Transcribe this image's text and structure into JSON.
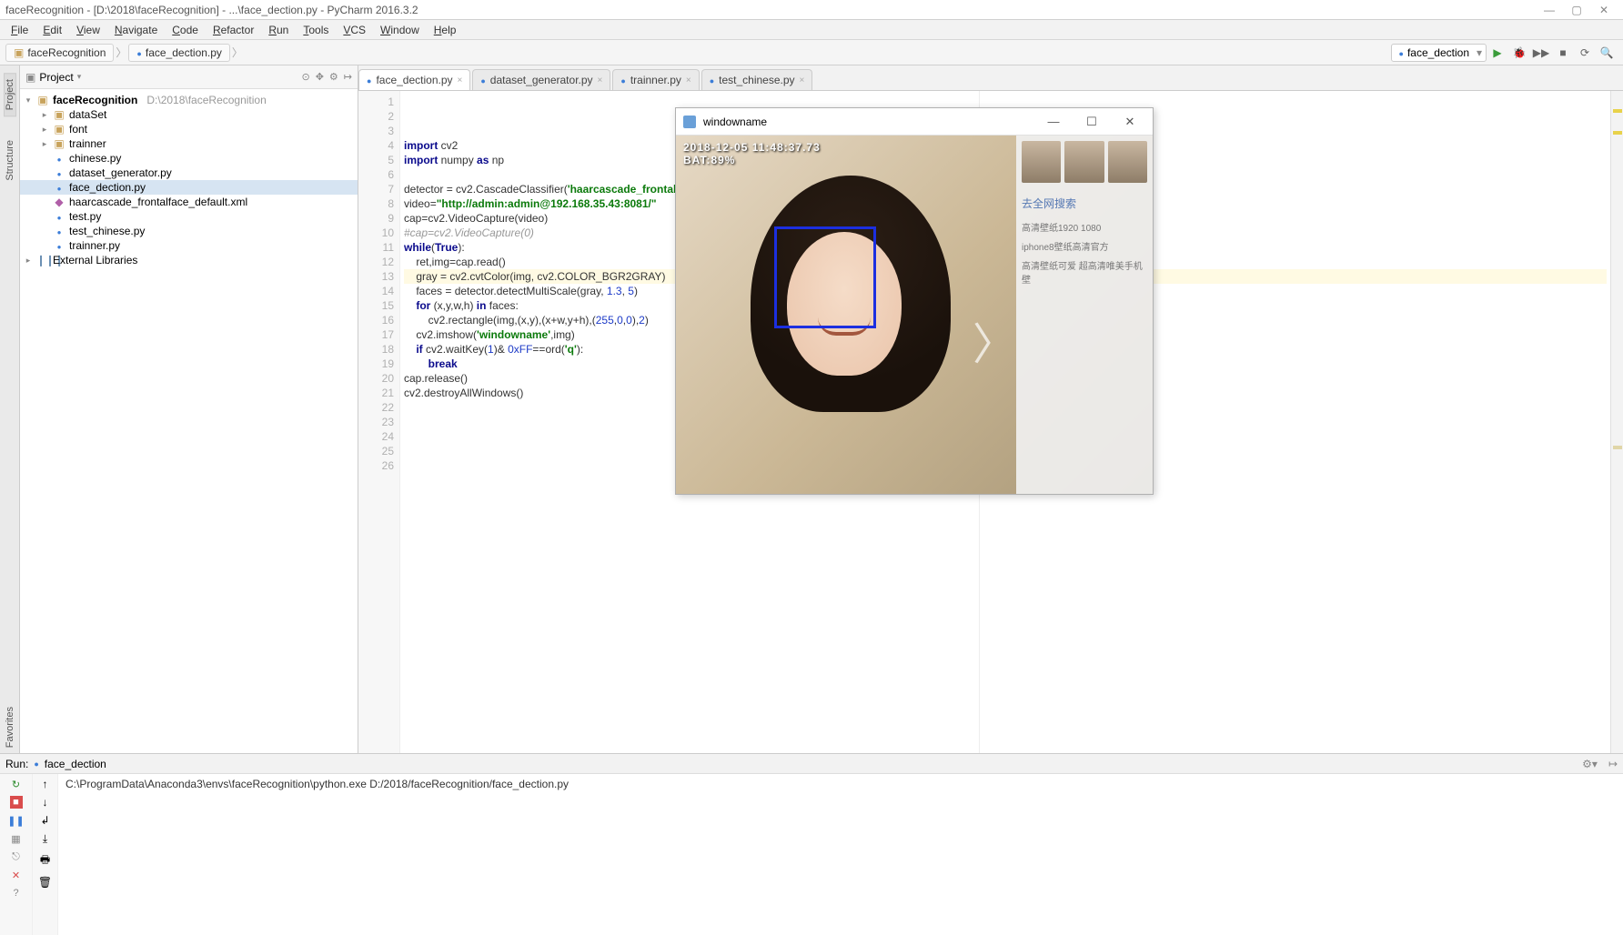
{
  "titlebar": {
    "text": "faceRecognition - [D:\\2018\\faceRecognition] - ...\\face_dection.py - PyCharm 2016.3.2"
  },
  "menu": {
    "items": [
      "File",
      "Edit",
      "View",
      "Navigate",
      "Code",
      "Refactor",
      "Run",
      "Tools",
      "VCS",
      "Window",
      "Help"
    ]
  },
  "breadcrumb": {
    "items": [
      "faceRecognition",
      "face_dection.py"
    ]
  },
  "run_config": {
    "selected": "face_dection"
  },
  "leftTabs": [
    "Project",
    "Structure"
  ],
  "leftBottomTab": "Favorites",
  "projectHeader": {
    "label": "Project"
  },
  "tree": {
    "root": {
      "name": "faceRecognition",
      "path": "D:\\2018\\faceRecognition"
    },
    "children": [
      {
        "name": "dataSet",
        "type": "folder"
      },
      {
        "name": "font",
        "type": "folder"
      },
      {
        "name": "trainner",
        "type": "folder"
      },
      {
        "name": "chinese.py",
        "type": "py"
      },
      {
        "name": "dataset_generator.py",
        "type": "py"
      },
      {
        "name": "face_dection.py",
        "type": "py",
        "selected": true
      },
      {
        "name": "haarcascade_frontalface_default.xml",
        "type": "xml"
      },
      {
        "name": "test.py",
        "type": "py"
      },
      {
        "name": "test_chinese.py",
        "type": "py"
      },
      {
        "name": "trainner.py",
        "type": "py"
      }
    ],
    "external": "External Libraries"
  },
  "editorTabs": [
    {
      "name": "face_dection.py",
      "active": true
    },
    {
      "name": "dataset_generator.py"
    },
    {
      "name": "trainner.py"
    },
    {
      "name": "test_chinese.py"
    }
  ],
  "code": {
    "lines": [
      {
        "n": 1,
        "segs": [
          [
            "kw",
            "import"
          ],
          [
            "op",
            " cv2"
          ]
        ]
      },
      {
        "n": 2,
        "segs": [
          [
            "kw",
            "import"
          ],
          [
            "op",
            " numpy "
          ],
          [
            "kw",
            "as"
          ],
          [
            "op",
            " np"
          ]
        ]
      },
      {
        "n": 3,
        "segs": [
          [
            "op",
            ""
          ]
        ]
      },
      {
        "n": 4,
        "segs": [
          [
            "op",
            "detector = cv2.CascadeClassifier("
          ],
          [
            "str",
            "'haarcascade_frontalface"
          ]
        ]
      },
      {
        "n": 5,
        "segs": [
          [
            "op",
            "video="
          ],
          [
            "str",
            "\"http://admin:admin@192.168.35.43:8081/\""
          ]
        ]
      },
      {
        "n": 6,
        "segs": [
          [
            "op",
            "cap=cv2.VideoCapture(video)"
          ]
        ]
      },
      {
        "n": 7,
        "segs": [
          [
            "com",
            "#cap=cv2.VideoCapture(0)"
          ]
        ]
      },
      {
        "n": 8,
        "segs": [
          [
            "kw",
            "while"
          ],
          [
            "op",
            "("
          ],
          [
            "bool",
            "True"
          ],
          [
            "op",
            ")"
          ],
          [
            "op",
            ":"
          ]
        ]
      },
      {
        "n": 9,
        "segs": [
          [
            "op",
            "    ret,img=cap.read()"
          ]
        ]
      },
      {
        "n": 10,
        "hl": true,
        "segs": [
          [
            "op",
            "    gray = cv2.cvtColor(img, cv2.COLOR_BGR2GRAY)"
          ]
        ]
      },
      {
        "n": 11,
        "segs": [
          [
            "op",
            "    faces = detector.detectMultiScale(gray, "
          ],
          [
            "num",
            "1.3"
          ],
          [
            "op",
            ", "
          ],
          [
            "num",
            "5"
          ],
          [
            "op",
            ")"
          ]
        ]
      },
      {
        "n": 12,
        "segs": [
          [
            "op",
            "    "
          ],
          [
            "kw",
            "for"
          ],
          [
            "op",
            " (x,y,w,h) "
          ],
          [
            "kw",
            "in"
          ],
          [
            "op",
            " faces:"
          ]
        ]
      },
      {
        "n": 13,
        "segs": [
          [
            "op",
            "        cv2.rectangle(img,(x,y),(x+w,y+h),("
          ],
          [
            "num",
            "255"
          ],
          [
            "op",
            ","
          ],
          [
            "num",
            "0"
          ],
          [
            "op",
            ","
          ],
          [
            "num",
            "0"
          ],
          [
            "op",
            "),"
          ],
          [
            "num",
            "2"
          ],
          [
            "op",
            ")"
          ]
        ]
      },
      {
        "n": 14,
        "segs": [
          [
            "op",
            "    cv2.imshow("
          ],
          [
            "str",
            "'windowname'"
          ],
          [
            "op",
            ",img)"
          ]
        ]
      },
      {
        "n": 15,
        "segs": [
          [
            "op",
            "    "
          ],
          [
            "kw",
            "if"
          ],
          [
            "op",
            " cv2.waitKey("
          ],
          [
            "num",
            "1"
          ],
          [
            "op",
            ")& "
          ],
          [
            "num",
            "0xFF"
          ],
          [
            "op",
            "==ord("
          ],
          [
            "str",
            "'q'"
          ],
          [
            "op",
            "):"
          ]
        ]
      },
      {
        "n": 16,
        "segs": [
          [
            "op",
            "        "
          ],
          [
            "kw",
            "break"
          ]
        ]
      },
      {
        "n": 17,
        "segs": [
          [
            "op",
            "cap.release()"
          ]
        ]
      },
      {
        "n": 18,
        "segs": [
          [
            "op",
            "cv2.destroyAllWindows()"
          ]
        ]
      },
      {
        "n": 19,
        "segs": [
          [
            "op",
            ""
          ]
        ]
      },
      {
        "n": 20,
        "segs": [
          [
            "op",
            ""
          ]
        ]
      },
      {
        "n": 21,
        "segs": [
          [
            "op",
            ""
          ]
        ]
      },
      {
        "n": 22,
        "segs": [
          [
            "op",
            ""
          ]
        ]
      },
      {
        "n": 23,
        "segs": [
          [
            "op",
            ""
          ]
        ]
      },
      {
        "n": 24,
        "segs": [
          [
            "op",
            ""
          ]
        ]
      },
      {
        "n": 25,
        "segs": [
          [
            "op",
            ""
          ]
        ]
      },
      {
        "n": 26,
        "segs": [
          [
            "op",
            ""
          ]
        ]
      }
    ]
  },
  "runPanel": {
    "label": "Run:",
    "config": "face_dection",
    "output": "C:\\ProgramData\\Anaconda3\\envs\\faceRecognition\\python.exe D:/2018/faceRecognition/face_dection.py"
  },
  "cvWindow": {
    "title": "windowname",
    "overlay_line1": "2018-12-05 11:48:37.73",
    "overlay_line2": "BAT:89%",
    "side_search": "去全网搜索",
    "side_lines": [
      "高清壁纸1920 1080",
      "iphone8壁纸高清官方",
      "高清壁纸可爱  超高清唯美手机壁"
    ]
  }
}
